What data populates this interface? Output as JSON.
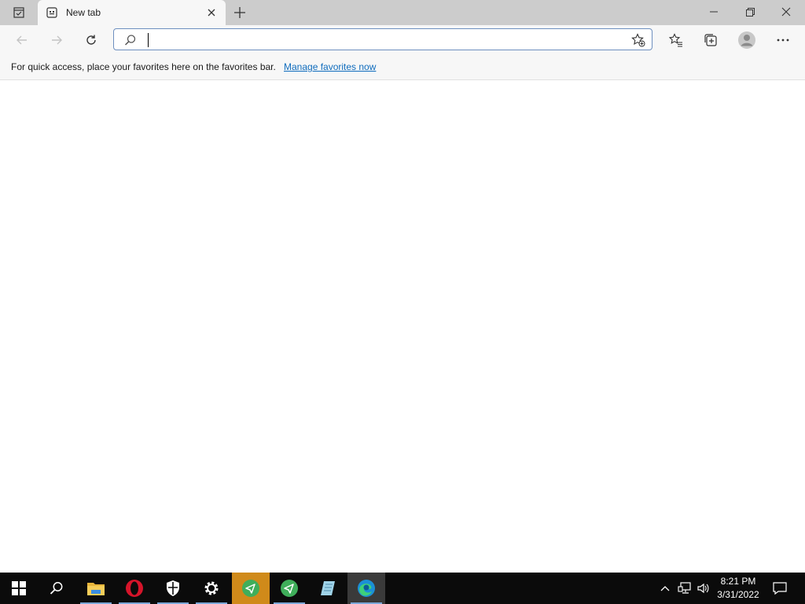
{
  "browser": {
    "tab": {
      "title": "New tab"
    },
    "address_bar": {
      "value": "",
      "placeholder": ""
    },
    "favorites_bar": {
      "message": "For quick access, place your favorites here on the favorites bar.",
      "link_label": "Manage favorites now"
    },
    "colors": {
      "accent": "#0f6cbd",
      "chrome": "#f7f7f7",
      "tabstrip": "#cccccc"
    }
  },
  "taskbar": {
    "apps": [
      "start-icon",
      "search-icon",
      "file-explorer-icon",
      "opera-icon",
      "security-shield-icon",
      "settings-icon",
      "send-app-icon",
      "send-app-icon",
      "notepad-icon",
      "edge-icon"
    ],
    "clock": {
      "time": "8:21 PM",
      "date": "3/31/2022"
    }
  }
}
